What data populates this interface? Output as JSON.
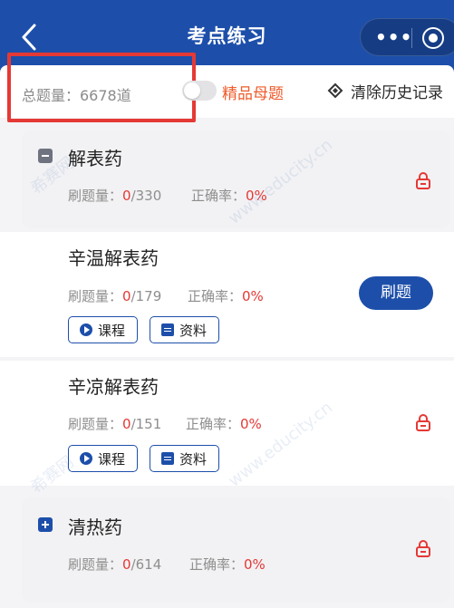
{
  "header": {
    "title": "考点练习",
    "more_label": "•••"
  },
  "toolbar": {
    "total_label": "总题量：6678道",
    "fine_label": "精品母题",
    "clear_label": "清除历史记录"
  },
  "groups": [
    {
      "title": "解表药",
      "count_label": "刷题量：",
      "count_done": "0",
      "count_total": "/330",
      "acc_label": "正确率：",
      "acc_value": "0%"
    },
    {
      "title": "清热药",
      "count_label": "刷题量：",
      "count_done": "0",
      "count_total": "/614",
      "acc_label": "正确率：",
      "acc_value": "0%"
    }
  ],
  "items": [
    {
      "title": "辛温解表药",
      "count_label": "刷题量：",
      "count_done": "0",
      "count_total": "/179",
      "acc_label": "正确率：",
      "acc_value": "0%",
      "course_label": "课程",
      "doc_label": "资料",
      "action_label": "刷题"
    },
    {
      "title": "辛凉解表药",
      "count_label": "刷题量：",
      "count_done": "0",
      "count_total": "/151",
      "acc_label": "正确率：",
      "acc_value": "0%",
      "course_label": "课程",
      "doc_label": "资料"
    }
  ],
  "watermark": "www.educity.cn",
  "watermark_brand": "希赛网",
  "colors": {
    "brand": "#1d4faa",
    "accent_red": "#e53935",
    "accent_orange": "#ef5b2b"
  }
}
